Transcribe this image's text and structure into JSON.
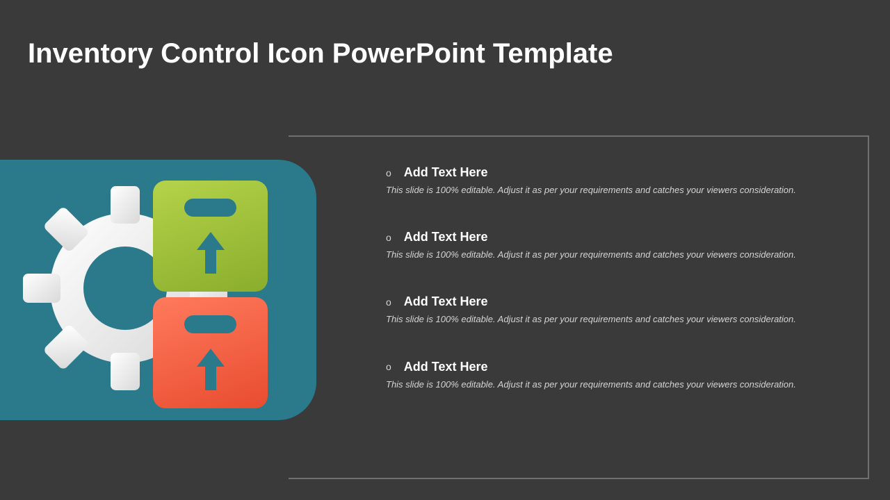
{
  "title": "Inventory Control Icon PowerPoint Template",
  "bullets": [
    {
      "heading": "Add Text Here",
      "desc": "This slide is 100% editable. Adjust it as per your requirements and catches your viewers consideration."
    },
    {
      "heading": "Add Text Here",
      "desc": "This slide is 100% editable. Adjust it as per your requirements and catches your viewers consideration."
    },
    {
      "heading": "Add Text Here",
      "desc": "This slide is 100% editable. Adjust it as per your requirements and catches your viewers consideration."
    },
    {
      "heading": "Add Text Here",
      "desc": "This slide is 100% editable. Adjust it as per your requirements and catches your viewers consideration."
    }
  ],
  "colors": {
    "background": "#3a3a3a",
    "panel": "#2a7a8c",
    "box_green_start": "#b5d34a",
    "box_green_end": "#8aad2c",
    "box_red_start": "#ff7a5c",
    "box_red_end": "#e84c30",
    "frame": "#707070"
  }
}
